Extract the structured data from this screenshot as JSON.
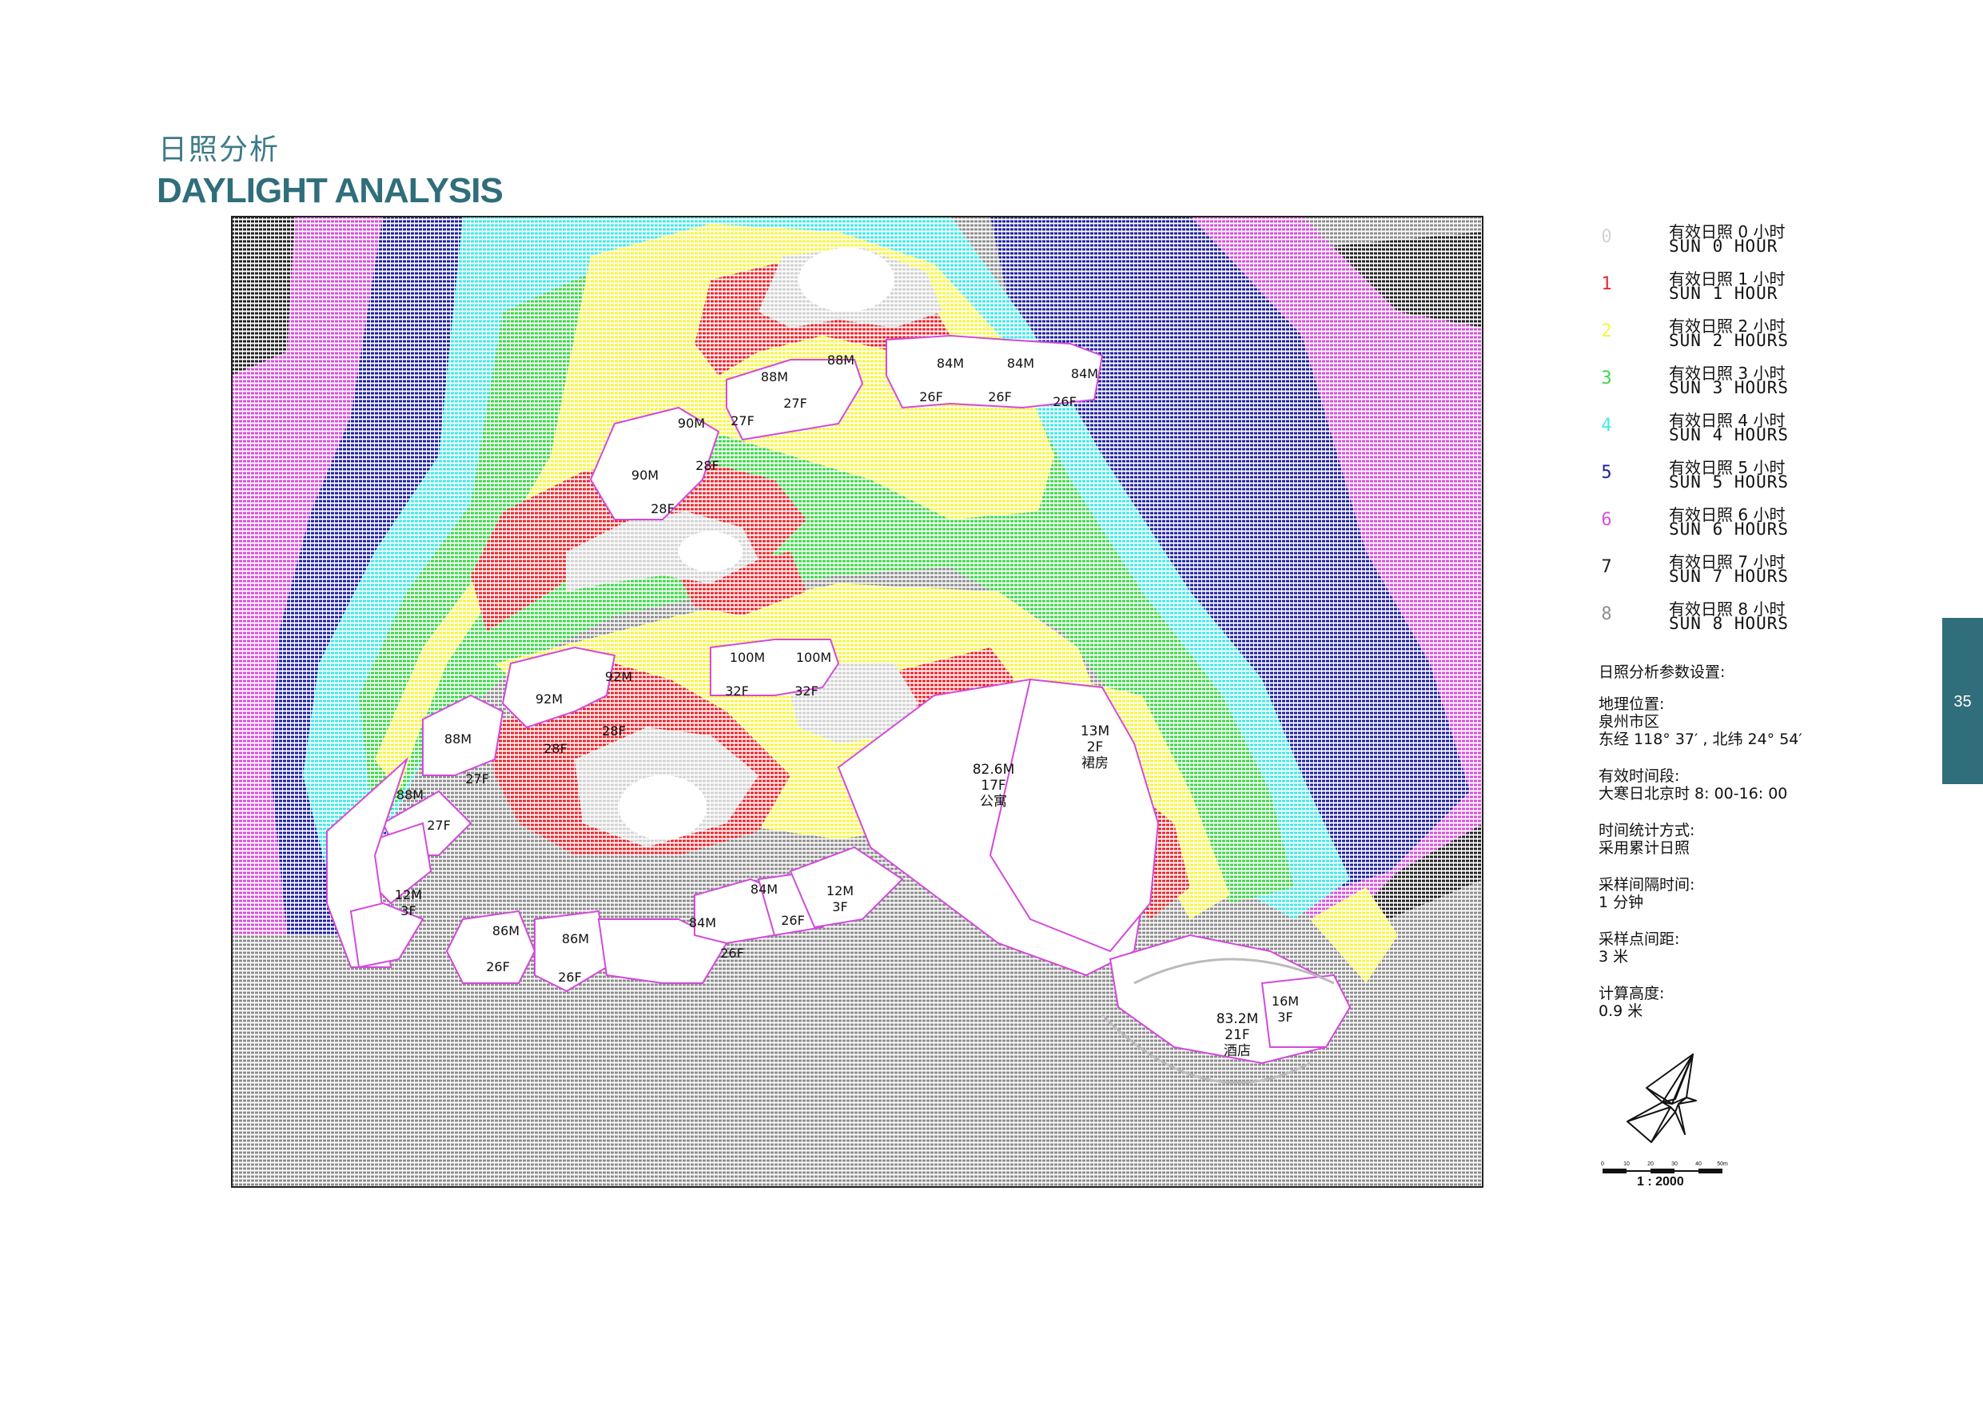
{
  "page": {
    "title_cn": "日照分析",
    "title_en": "DAYLIGHT ANALYSIS",
    "page_number": "35"
  },
  "legend": [
    {
      "num": "0",
      "cn": "有效日照 0 小时",
      "en": "SUN  0  HOUR",
      "color": "#d2d2d2"
    },
    {
      "num": "1",
      "cn": "有效日照 1 小时",
      "en": "SUN  1  HOUR",
      "color": "#e8272e"
    },
    {
      "num": "2",
      "cn": "有效日照 2 小时",
      "en": "SUN  2  HOURS",
      "color": "#f5f542"
    },
    {
      "num": "3",
      "cn": "有效日照 3 小时",
      "en": "SUN  3  HOURS",
      "color": "#3fd64b"
    },
    {
      "num": "4",
      "cn": "有效日照 4 小时",
      "en": "SUN  4  HOURS",
      "color": "#43e8e6"
    },
    {
      "num": "5",
      "cn": "有效日照 5 小时",
      "en": "SUN  5  HOURS",
      "color": "#1f1f9e"
    },
    {
      "num": "6",
      "cn": "有效日照 6 小时",
      "en": "SUN  6  HOURS",
      "color": "#d94fdc"
    },
    {
      "num": "7",
      "cn": "有效日照 7 小时",
      "en": "SUN  7  HOURS",
      "color": "#222222"
    },
    {
      "num": "8",
      "cn": "有效日照 8 小时",
      "en": "SUN  8  HOURS",
      "color": "#8e8e8e"
    }
  ],
  "params": {
    "heading": "日照分析参数设置:",
    "location_label": "地理位置:",
    "location_city": "泉州市区",
    "location_coords": "东经 118° 37′ , 北纬 24° 54′",
    "period_label": "有效时间段:",
    "period_value": "大寒日北京时 8: 00-16: 00",
    "method_label": "时间统计方式:",
    "method_value": "采用累计日照",
    "interval_label": "采样间隔时间:",
    "interval_value": "1 分钟",
    "spacing_label": "采样点间距:",
    "spacing_value": "3 米",
    "height_label": "计算高度:",
    "height_value": "0.9 米"
  },
  "scale": {
    "ticks": [
      "0",
      "10",
      "20",
      "30",
      "40",
      "50m"
    ],
    "label": "1 : 2000"
  },
  "buildings": [
    [
      "84M"
    ],
    [
      "84M"
    ],
    [
      "84M"
    ],
    [
      "26F"
    ],
    [
      "26F"
    ],
    [
      "26F"
    ],
    [
      "88M"
    ],
    [
      "88M"
    ],
    [
      "27F"
    ],
    [
      "27F"
    ],
    [
      "90M"
    ],
    [
      "90M"
    ],
    [
      "28F"
    ],
    [
      "28F"
    ],
    [
      "100M"
    ],
    [
      "100M"
    ],
    [
      "32F"
    ],
    [
      "32F"
    ],
    [
      "92M"
    ],
    [
      "92M"
    ],
    [
      "28F"
    ],
    [
      "28F"
    ],
    [
      "88M"
    ],
    [
      "27F"
    ],
    [
      "88M"
    ],
    [
      "27F"
    ],
    [
      "12M",
      "3F"
    ],
    [
      "12M",
      "3F"
    ],
    [
      "86M"
    ],
    [
      "86M"
    ],
    [
      "26F"
    ],
    [
      "26F"
    ],
    [
      "84M"
    ],
    [
      "84M"
    ],
    [
      "26F"
    ],
    [
      "26F"
    ],
    [
      "82.6M",
      "17F",
      "公寓"
    ],
    [
      "13M",
      "2F",
      "裙房"
    ],
    [
      "83.2M",
      "21F",
      "酒店"
    ],
    [
      "16M",
      "3F"
    ]
  ]
}
